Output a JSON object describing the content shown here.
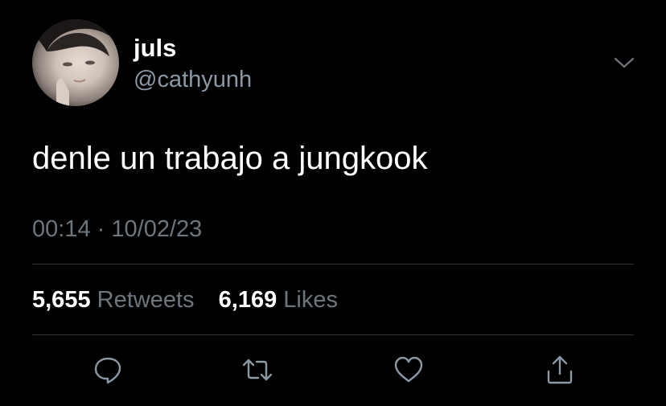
{
  "tweet": {
    "display_name": "juls",
    "handle": "@cathyunh",
    "text": "denle un trabajo a jungkook",
    "time": "00:14",
    "separator": "·",
    "date": "10/02/23",
    "retweets_count": "5,655",
    "retweets_label": "Retweets",
    "likes_count": "6,169",
    "likes_label": "Likes"
  },
  "icons": {
    "menu": "chevron-down-icon",
    "reply": "reply-icon",
    "retweet": "retweet-icon",
    "like": "heart-icon",
    "share": "share-icon"
  },
  "colors": {
    "background": "#000000",
    "primary_text": "#ffffff",
    "secondary_text": "#6e767d",
    "handle_text": "#8b98a5",
    "divider": "#2f3336",
    "icon": "#8b98a5"
  }
}
